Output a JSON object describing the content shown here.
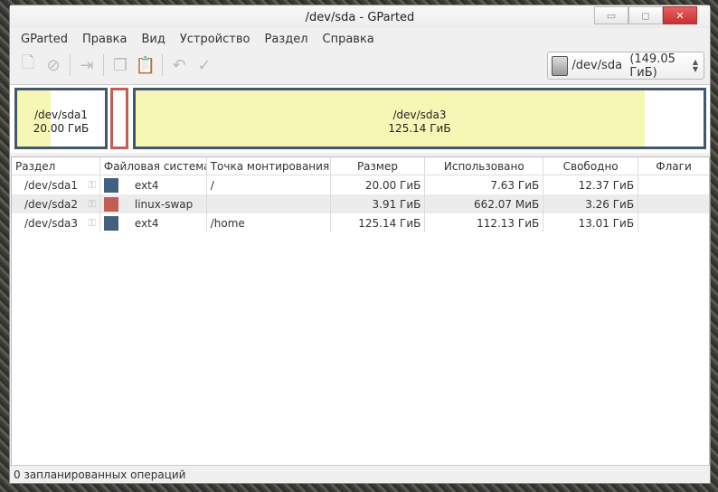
{
  "window": {
    "title": "/dev/sda - GParted",
    "minimize": "▭",
    "maximize": "◻",
    "close": "✕"
  },
  "menu": [
    "GParted",
    "Правка",
    "Вид",
    "Устройство",
    "Раздел",
    "Справка"
  ],
  "device": {
    "name": "/dev/sda",
    "size": "(149.05 ГиБ)"
  },
  "map": [
    {
      "name": "/dev/sda1",
      "size": "20.00 ГиБ",
      "used_fraction": 0.38,
      "color": "#43576d"
    },
    {
      "name": "/dev/sda2",
      "size": "",
      "used_fraction": 0,
      "color": "#c45e55"
    },
    {
      "name": "/dev/sda3",
      "size": "125.14 ГиБ",
      "used_fraction": 0.896,
      "color": "#43576d"
    }
  ],
  "table": {
    "headers": [
      "Раздел",
      "Файловая система",
      "Точка монтирования",
      "Размер",
      "Использовано",
      "Свободно",
      "Флаги"
    ],
    "rows": [
      {
        "partition": "/dev/sda1",
        "fs": "ext4",
        "color": "#43607f",
        "mount": "/",
        "size": "20.00 ГиБ",
        "used": "7.63 ГиБ",
        "free": "12.37 ГиБ",
        "flags": ""
      },
      {
        "partition": "/dev/sda2",
        "fs": "linux-swap",
        "color": "#c45e55",
        "mount": "",
        "size": "3.91 ГиБ",
        "used": "662.07 МиБ",
        "free": "3.26 ГиБ",
        "flags": ""
      },
      {
        "partition": "/dev/sda3",
        "fs": "ext4",
        "color": "#43607f",
        "mount": "/home",
        "size": "125.14 ГиБ",
        "used": "112.13 ГиБ",
        "free": "13.01 ГиБ",
        "flags": ""
      }
    ]
  },
  "status": "0 запланированных операций"
}
